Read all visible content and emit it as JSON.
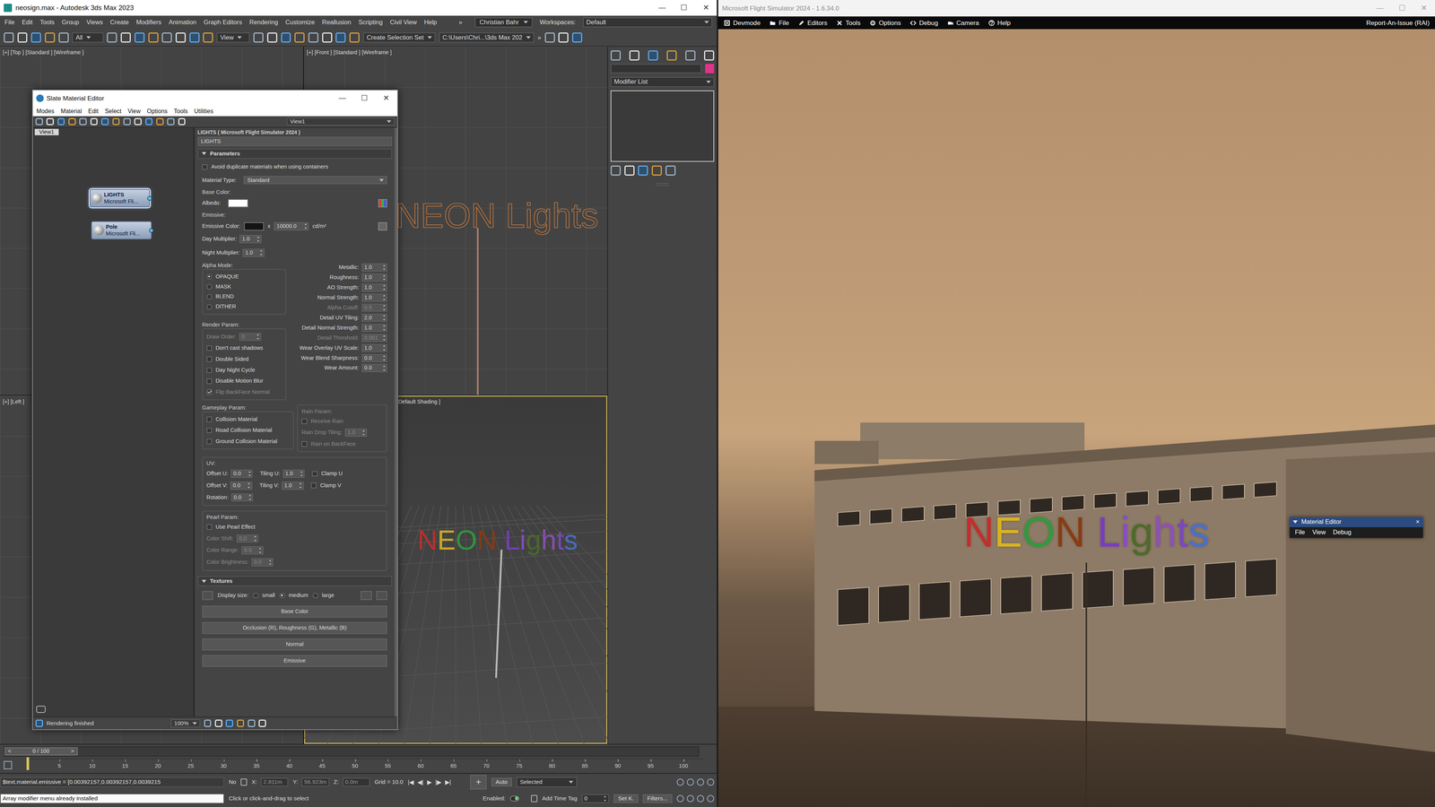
{
  "max": {
    "title": "neosign.max - Autodesk 3ds Max 2023",
    "window_controls": [
      "—",
      "☐",
      "✕"
    ],
    "menu": [
      "File",
      "Edit",
      "Tools",
      "Group",
      "Views",
      "Create",
      "Modifiers",
      "Animation",
      "Graph Editors",
      "Rendering",
      "Customize",
      "Reallusion",
      "Scripting",
      "Civil View",
      "Help"
    ],
    "menu_more": "»",
    "user": "Christian Bahr",
    "workspaces_label": "Workspaces:",
    "workspace": "Default",
    "toolbar": {
      "filter": "All",
      "ref_coord": "View",
      "selection_set": "Create Selection Set",
      "project_path": "C:\\Users\\Chri...\\3ds Max 202",
      "more": "»"
    },
    "viewports": [
      {
        "label": "[+] [Top ] [Standard ] [Wireframe ]",
        "active": false
      },
      {
        "label": "[+] [Front ] [Standard ] [Wireframe ]",
        "active": false
      },
      {
        "label": "[+] [Left ]",
        "active": false
      },
      {
        "label": "Default Shading ]",
        "active": true
      }
    ],
    "front_view_text": "NEON Lights",
    "command_panel": {
      "modifier_list": "Modifier List",
      "object_color": "#e0338a"
    },
    "timeline": {
      "frame": "0 / 100",
      "prev": "<",
      "next": ">",
      "level": 0,
      "ticks": [
        "5",
        "10",
        "15",
        "20",
        "25",
        "30",
        "35",
        "40",
        "45",
        "50",
        "55",
        "60",
        "65",
        "70",
        "75",
        "80",
        "85",
        "90",
        "95",
        "100"
      ]
    },
    "status": {
      "script_input": "$text.material.emissive = [0.00392157,0.00392157,0.0039215",
      "script_output": "Array modifier menu already installed",
      "selection": "No",
      "coords": [
        {
          "label": "X:",
          "value": "2.811m"
        },
        {
          "label": "Y:",
          "value": "56.923m"
        },
        {
          "label": "Z:",
          "value": "0.0m"
        }
      ],
      "grid": "Grid = 10.0",
      "playback": [
        "|◀",
        "◀|",
        "▶",
        "|▶",
        "▶|"
      ],
      "key_button": "+",
      "key_mode": "Auto",
      "key_filter": "Selected",
      "prompt": "Click or click-and-drag to select",
      "enabled_label": "Enabled:",
      "enabled": true,
      "time_tag": "Add Time Tag",
      "frame": "0",
      "set_key": "Set K.",
      "filters": "Filters..."
    }
  },
  "scene_sign": {
    "words": [
      {
        "letters": [
          {
            "char": "N",
            "color": "#c62d2a"
          },
          {
            "char": "E",
            "color": "#d9b31f"
          },
          {
            "char": "O",
            "color": "#2e9c3c"
          },
          {
            "char": "N",
            "color": "#8b3b12"
          }
        ]
      },
      {
        "letters": [
          {
            "char": "L",
            "color": "#7a3cc4"
          },
          {
            "char": "i",
            "color": "#8a4cc8"
          },
          {
            "char": "g",
            "color": "#4d6b2b"
          },
          {
            "char": "h",
            "color": "#8e50b8"
          },
          {
            "char": "t",
            "color": "#7a4ab8"
          },
          {
            "char": "s",
            "color": "#4a70c8"
          }
        ]
      }
    ]
  },
  "slate": {
    "title": "Slate Material Editor",
    "window_controls": [
      "—",
      "☐",
      "✕"
    ],
    "menu": [
      "Modes",
      "Material",
      "Edit",
      "Select",
      "View",
      "Options",
      "Tools",
      "Utilities"
    ],
    "view_dropdown": "View1",
    "view_tab": "View1",
    "nodes": [
      {
        "name": "LIGHTS",
        "type": "Microsoft Fli...",
        "selected": true
      },
      {
        "name": "Pole",
        "type": "Microsoft Fli...",
        "selected": false
      }
    ],
    "panel_title": "LIGHTS ( Microsoft Flight Simulator 2024 )",
    "material_name": "LIGHTS",
    "params": {
      "section": "Parameters",
      "avoid_dup": {
        "label": "Avoid duplicate materials when using containers",
        "checked": false
      },
      "material_type": {
        "label": "Material Type:",
        "value": "Standard"
      },
      "base_color": {
        "label": "Base Color:",
        "albedo_label": "Albedo:",
        "color": "#ffffff"
      },
      "emissive": {
        "label": "Emissive:",
        "color_label": "Emissive Color:",
        "color": "#141414",
        "times": "x",
        "value": "10000.0",
        "unit": "cd/m²",
        "multipliers": [
          {
            "label": "Day Multiplier:",
            "value": "1.0"
          },
          {
            "label": "Night Multiplier:",
            "value": "1.0"
          }
        ]
      },
      "alpha_mode": {
        "label": "Alpha Mode:",
        "options": [
          {
            "label": "OPAQUE",
            "selected": true
          },
          {
            "label": "MASK",
            "selected": false
          },
          {
            "label": "BLEND",
            "selected": false
          },
          {
            "label": "DITHER",
            "selected": false
          }
        ]
      },
      "numbers": [
        {
          "label": "Metallic:",
          "value": "1.0",
          "disabled": false
        },
        {
          "label": "Roughness:",
          "value": "1.0",
          "disabled": false
        },
        {
          "label": "AO Strength:",
          "value": "1.0",
          "disabled": false
        },
        {
          "label": "Normal Strength:",
          "value": "1.0",
          "disabled": false
        },
        {
          "label": "Alpha Cutoff:",
          "value": "0.5",
          "disabled": true
        },
        {
          "label": "Detail UV Tiling:",
          "value": "2.0",
          "disabled": false
        },
        {
          "label": "Detail Normal Strength:",
          "value": "1.0",
          "disabled": false
        },
        {
          "label": "Detail Threshold:",
          "value": "0.001",
          "disabled": true
        },
        {
          "label": "Wear Overlay UV Scale:",
          "value": "1.0",
          "disabled": false
        },
        {
          "label": "Wear Blend Sharpness:",
          "value": "0.0",
          "disabled": false
        },
        {
          "label": "Wear Amount:",
          "value": "0.0",
          "disabled": false
        }
      ],
      "render": {
        "label": "Render Param:",
        "draw_order": {
          "label": "Draw Order:",
          "value": "0",
          "disabled": true
        },
        "checks": [
          {
            "label": "Don't cast shadows",
            "checked": false,
            "disabled": false
          },
          {
            "label": "Double Sided",
            "checked": false,
            "disabled": false
          },
          {
            "label": "Day Night Cycle",
            "checked": false,
            "disabled": false
          },
          {
            "label": "Disable Motion Blur",
            "checked": false,
            "disabled": false
          },
          {
            "label": "Flip BackFace Normal",
            "checked": true,
            "disabled": true
          }
        ]
      },
      "gameplay": {
        "label": "Gameplay Param:",
        "checks": [
          {
            "label": "Collision Material",
            "checked": false,
            "disabled": false
          },
          {
            "label": "Road Collision Material",
            "checked": false,
            "disabled": false
          },
          {
            "label": "Ground Collision Material",
            "checked": false,
            "disabled": false
          }
        ]
      },
      "rain": {
        "label": "Rain Param:",
        "disabled": true,
        "items": [
          {
            "kind": "check",
            "label": "Receive Rain",
            "checked": false,
            "disabled": true
          },
          {
            "kind": "number",
            "label": "Rain Drop Tiling:",
            "value": "1.0",
            "disabled": true
          },
          {
            "kind": "check",
            "label": "Rain on BackFace",
            "checked": false,
            "disabled": true
          }
        ]
      },
      "uv": {
        "label": "UV:",
        "rows": [
          [
            {
              "kind": "number",
              "label": "Offset U:",
              "value": "0.0",
              "disabled": false
            },
            {
              "kind": "number",
              "label": "Tiling U:",
              "value": "1.0",
              "disabled": false
            },
            {
              "kind": "check",
              "label": "Clamp U",
              "checked": false,
              "disabled": false
            }
          ],
          [
            {
              "kind": "number",
              "label": "Offset V:",
              "value": "0.0",
              "disabled": false
            },
            {
              "kind": "number",
              "label": "Tiling V:",
              "value": "1.0",
              "disabled": false
            },
            {
              "kind": "check",
              "label": "Clamp V",
              "checked": false,
              "disabled": false
            }
          ],
          [
            {
              "kind": "number",
              "label": "Rotation:",
              "value": "0.0",
              "disabled": false
            }
          ]
        ]
      },
      "pearl": {
        "label": "Pearl Param:",
        "use": {
          "label": "Use Pearl Effect",
          "checked": false,
          "disabled": false
        },
        "fields": [
          {
            "label": "Color Shift:",
            "value": "0.0",
            "disabled": true
          },
          {
            "label": "Color Range:",
            "value": "0.0",
            "disabled": true
          },
          {
            "label": "Color Brightness:",
            "value": "0.0",
            "disabled": true
          }
        ]
      },
      "textures": {
        "section": "Textures",
        "display_label": "Display size:",
        "sizes": [
          {
            "label": "small",
            "selected": false
          },
          {
            "label": "medium",
            "selected": true
          },
          {
            "label": "large",
            "selected": false
          }
        ],
        "slots": [
          "Base Color",
          "Occlusion (R), Roughness (G), Metallic (B)",
          "Normal",
          "Emissive"
        ]
      }
    },
    "status": "Rendering finished",
    "zoom": "100%"
  },
  "msfs": {
    "title": "Microsoft Flight Simulator 2024 - 1.6.34.0",
    "window_controls": [
      "—",
      "☐",
      "✕"
    ],
    "devmode_menu": [
      "Devmode",
      "File",
      "Editors",
      "Tools",
      "Options",
      "Debug",
      "Camera",
      "Help"
    ],
    "rai": "Report-An-Issue (RAI)",
    "material_editor": {
      "title": "Material Editor",
      "expanded": true,
      "menu": [
        "File",
        "View",
        "Debug"
      ],
      "close": "×"
    }
  }
}
